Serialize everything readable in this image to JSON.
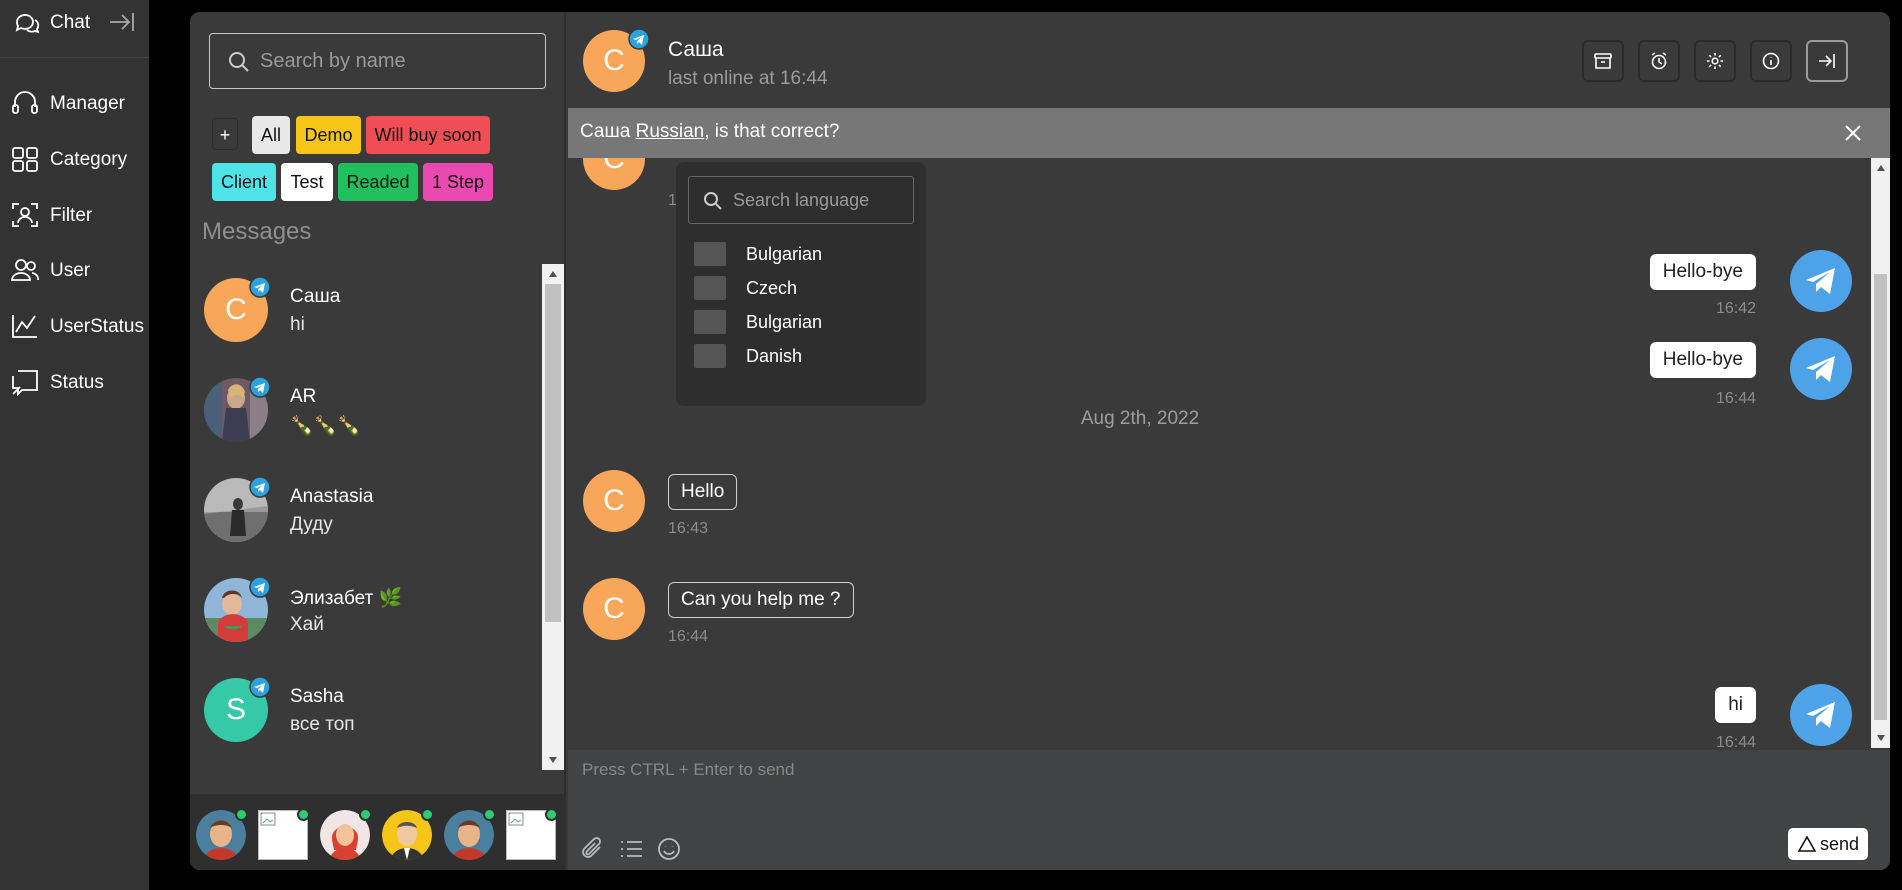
{
  "nav": {
    "chat_label": "Chat",
    "items": [
      {
        "label": "Manager",
        "icon": "headset-icon"
      },
      {
        "label": "Category",
        "icon": "grid-icon"
      },
      {
        "label": "Filter",
        "icon": "user-focus-icon"
      },
      {
        "label": "User",
        "icon": "users-icon"
      },
      {
        "label": "UserStatus",
        "icon": "line-chart-icon"
      },
      {
        "label": "Status",
        "icon": "chat-square-icon"
      }
    ]
  },
  "sidebar": {
    "search_placeholder": "Search by name",
    "add_tag_label": "+",
    "tags": [
      {
        "label": "All",
        "color": "#e8e8e8"
      },
      {
        "label": "Demo",
        "color": "#f5c518"
      },
      {
        "label": "Will buy soon",
        "color": "#f04d55"
      },
      {
        "label": "Client",
        "color": "#4ee3e6"
      },
      {
        "label": "Test",
        "color": "#ffffff"
      },
      {
        "label": "Readed",
        "color": "#20c05c"
      },
      {
        "label": "1 Step",
        "color": "#ea49b1"
      }
    ],
    "messages_title": "Messages",
    "conversations": [
      {
        "name": "Саша",
        "last": "hi",
        "letter": "С",
        "avatar_color": "#f7a65a"
      },
      {
        "name": "AR",
        "last": "🍾🍾🍾"
      },
      {
        "name": "Anastasia",
        "last": "Дуду"
      },
      {
        "name": "Элизабет 🌿",
        "last": "Хай"
      },
      {
        "name": "Sasha",
        "last": "все топ",
        "letter": "S",
        "avatar_color": "#35c9a8"
      }
    ]
  },
  "chat": {
    "contact_name": "Саша",
    "contact_letter": "С",
    "contact_status": "last online at 16:44",
    "banner": {
      "prefix": "Саша ",
      "language": "Russian",
      "suffix": ", is that correct?"
    },
    "language_picker": {
      "search_placeholder": "Search language",
      "options": [
        "Bulgarian",
        "Czech",
        "Bulgarian",
        "Danish"
      ]
    },
    "partial_time": "1",
    "date_separator": "Aug 2th, 2022",
    "messages": [
      {
        "text": "Hello-bye",
        "time": "16:42"
      },
      {
        "text": "Hello-bye",
        "time": "16:44"
      },
      {
        "text": "Hello",
        "time": "16:43"
      },
      {
        "text": "Can you help me ?",
        "time": "16:44"
      },
      {
        "text": "hi",
        "time": "16:44"
      }
    ],
    "composer_placeholder": "Press CTRL + Enter to send",
    "send_label": "send"
  }
}
